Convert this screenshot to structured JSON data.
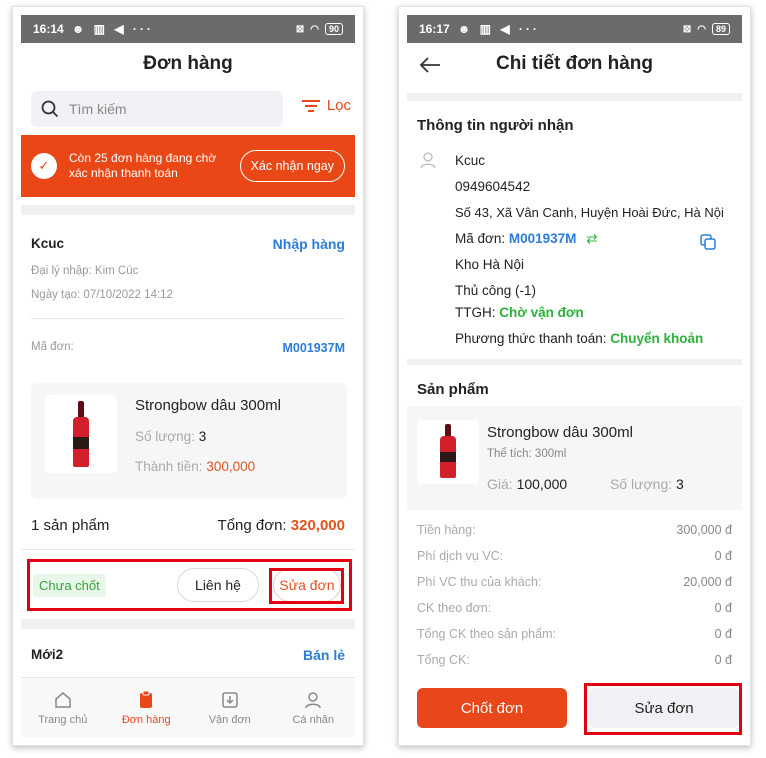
{
  "left": {
    "status": {
      "time": "16:14",
      "icons": "☻ ▥ ◀ ···",
      "battery": "90"
    },
    "title": "Đơn hàng",
    "search_placeholder": "Tìm kiếm",
    "filter_label": "Lọc",
    "banner": {
      "text": "Còn 25 đơn hàng đang chờ xác nhận thanh toán",
      "button": "Xác nhận ngay"
    },
    "order": {
      "customer": "Kcuc",
      "action_link": "Nhập hàng",
      "agent": "Đại lý nhập: Kim Cúc",
      "created": "Ngày tạo: 07/10/2022 14:12",
      "code_label": "Mã đơn:",
      "code": "M001937M",
      "product": {
        "name": "Strongbow dâu 300ml",
        "qty_label": "Số lượng:",
        "qty": "3",
        "total_label": "Thành tiền:",
        "total": "300,000"
      },
      "count_text": "1 sản phẩm",
      "total_label": "Tổng đơn:",
      "total_value": "320,000",
      "status_badge": "Chưa chốt",
      "contact_button": "Liên hệ",
      "edit_button": "Sửa đơn"
    },
    "next_order": {
      "customer": "Mới2",
      "action_link": "Bán lẻ"
    },
    "tabs": [
      {
        "label": "Trang chủ"
      },
      {
        "label": "Đơn hàng"
      },
      {
        "label": "Vận đơn"
      },
      {
        "label": "Cá nhân"
      }
    ],
    "active_tab_color": "#e8461b"
  },
  "right": {
    "status": {
      "time": "16:17",
      "icons": "☻ ▥ ◀ ···",
      "battery": "89"
    },
    "title": "Chi tiết đơn hàng",
    "recipient_heading": "Thông tin người nhận",
    "recipient": {
      "name": "Kcuc",
      "phone": "0949604542",
      "address": "Số 43, Xã Vân Canh, Huyện Hoài Đức, Hà Nội",
      "code_label": "Mã đơn:",
      "code": "M001937M",
      "warehouse": "Kho Hà Nội",
      "manual": "Thủ công (-1)",
      "ship_label": "TTGH:",
      "ship_status": "Chờ vận đơn",
      "payment_label": "Phương thức thanh toán:",
      "payment": "Chuyển khoản"
    },
    "products_heading": "Sản phẩm",
    "product": {
      "name": "Strongbow dâu 300ml",
      "volume": "Thể tích: 300ml",
      "price_label": "Giá:",
      "price": "100,000",
      "qty_label": "Số lượng:",
      "qty": "3"
    },
    "summary": [
      {
        "label": "Tiền hàng:",
        "value": "300,000 đ"
      },
      {
        "label": "Phí dịch vụ VC:",
        "value": "0 đ"
      },
      {
        "label": "Phí VC thu của khách:",
        "value": "20,000 đ"
      },
      {
        "label": "CK theo đơn:",
        "value": "0 đ"
      },
      {
        "label": "Tổng CK theo sản phẩm:",
        "value": "0 đ"
      },
      {
        "label": "Tổng CK:",
        "value": "0 đ"
      }
    ],
    "confirm_button": "Chốt đơn",
    "edit_button": "Sửa đơn"
  }
}
